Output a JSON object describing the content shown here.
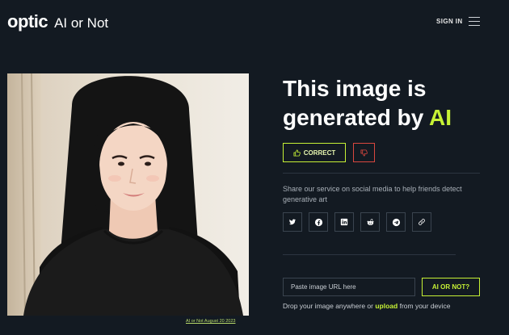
{
  "header": {
    "brand": "optic",
    "product": "AI or Not",
    "signin_label": "SIGN IN"
  },
  "result": {
    "headline_prefix": "This image is generated by",
    "headline_highlight": "AI",
    "correct_label": "CORRECT",
    "share_text": "Share our service on social media to help friends detect generative art"
  },
  "image": {
    "caption": "AI or Not August 20 2023"
  },
  "social": [
    {
      "icon": "twitter-icon"
    },
    {
      "icon": "facebook-icon"
    },
    {
      "icon": "linkedin-icon"
    },
    {
      "icon": "reddit-icon"
    },
    {
      "icon": "telegram-icon"
    },
    {
      "icon": "link-icon"
    }
  ],
  "upload": {
    "url_placeholder": "Paste image URL here",
    "submit_label": "AI OR NOT?",
    "drop_prefix": "Drop your image anywhere or",
    "drop_link": "upload",
    "drop_suffix": "from your device"
  },
  "colors": {
    "background": "#131a22",
    "accent": "#c6f135",
    "dislike": "#d9473f"
  }
}
